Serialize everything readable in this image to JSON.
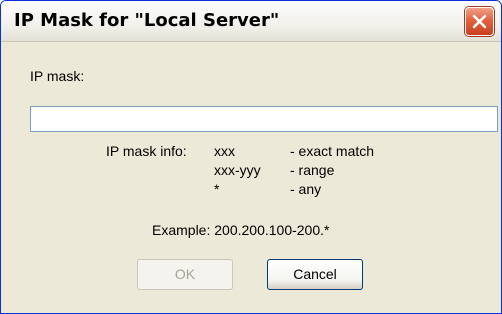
{
  "window": {
    "title": "IP Mask for \"Local Server\""
  },
  "form": {
    "ip_mask_label": "IP mask:",
    "ip_mask_value": "",
    "info_title": "IP mask info:",
    "info_rows": [
      {
        "key": "xxx",
        "desc": "- exact match"
      },
      {
        "key": "xxx-yyy",
        "desc": "- range"
      },
      {
        "key": "*",
        "desc": "- any"
      }
    ],
    "example": "Example: 200.200.100-200.*"
  },
  "buttons": {
    "ok_label": "OK",
    "ok_enabled": false,
    "cancel_label": "Cancel"
  },
  "colors": {
    "titlebar": "#f2f1ec",
    "dialog_bg": "#ece9d8",
    "close_button": "#e2613f",
    "window_border": "#0831d9",
    "input_border": "#7f9db9",
    "disabled_text": "#a6a49a"
  },
  "icons": {
    "close": "close-icon"
  }
}
